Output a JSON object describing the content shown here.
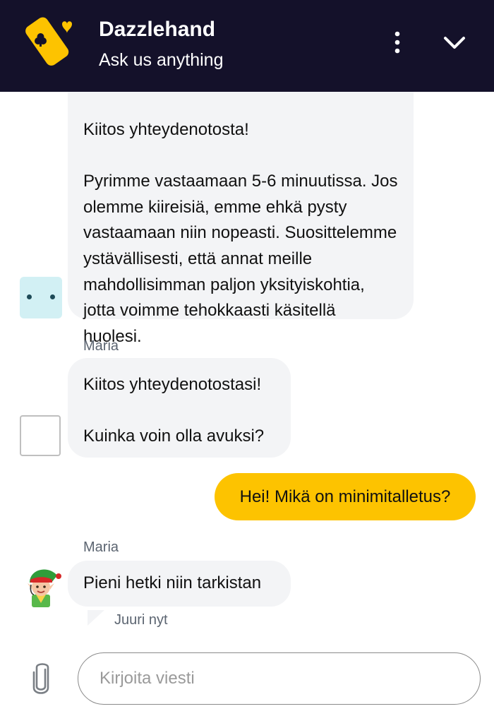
{
  "header": {
    "title": "Dazzlehand",
    "subtitle": "Ask us anything",
    "logo_icon": "yellow-tag-club-heart-logo",
    "menu_icon": "vertical-dots-icon",
    "collapse_icon": "chevron-down-icon",
    "background": "#14112a"
  },
  "messages": [
    {
      "text": "Kiitos yhteydenotosta!\n\nPyrimme vastaamaan 5-6 minuutissa. Jos olemme kiireisiä, emme ehkä pysty vastaamaan niin nopeasti. Suosittelemme ystävällisesti, että annat meille mahdollisimman paljon yksityiskohtia, jotta voimme tehokkaasti käsitellä huolesi."
    },
    {
      "sender": "Maria",
      "text": "Kiitos yhteydenotostasi!\n\nKuinka voin olla avuksi?"
    },
    {
      "sender": "Maria",
      "text": "Pieni hetki niin tarkistan"
    }
  ],
  "user_message": {
    "text": "Hei! Mikä on minimitalletus?",
    "color": "#fdc300"
  },
  "timestamp": "Juuri nyt",
  "composer": {
    "placeholder": "Kirjoita viesti",
    "attach_icon": "paperclip-icon"
  }
}
